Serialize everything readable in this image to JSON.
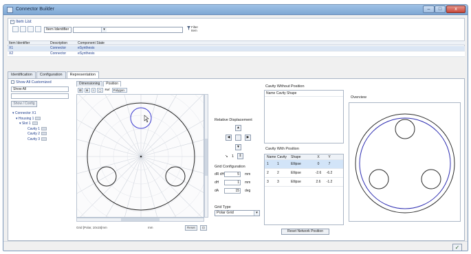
{
  "window": {
    "title": "Connector Builder",
    "minimize": "–",
    "maximize": "□",
    "close": "x"
  },
  "items_list": {
    "header": "Item List",
    "identifier_combo": "Item Identifier",
    "filter_label": "Filter\nItem",
    "columns": [
      "Item Identifier",
      "Description",
      "Component State"
    ],
    "rows": [
      {
        "id": "X1",
        "desc": "Connector",
        "state": "eSynthesis"
      },
      {
        "id": "X2",
        "desc": "Connector",
        "state": "eSynthesis"
      }
    ]
  },
  "tabs": [
    "Identification",
    "Configuration",
    "Representation"
  ],
  "left_panel": {
    "header": "Show All Customized",
    "show_all": "Show All",
    "blank_field": "",
    "button": "Show / Config",
    "tree": [
      {
        "label": "Connector X1",
        "indent": 0,
        "prefix": "▾ "
      },
      {
        "label": "Housing 1",
        "indent": 1,
        "prefix": "▾ ",
        "chip": true
      },
      {
        "label": "Slot 1",
        "indent": 2,
        "prefix": "▾ ",
        "chip": true
      },
      {
        "label": "Cavity 1",
        "indent": 3,
        "prefix": "",
        "chip": true
      },
      {
        "label": "Cavity 2",
        "indent": 3,
        "prefix": "",
        "chip": true
      },
      {
        "label": "Cavity 3",
        "indent": 3,
        "prefix": "",
        "chip": true
      }
    ]
  },
  "canvas": {
    "subtabs": [
      "Dimensioning",
      "Position"
    ],
    "tool_labels": [
      "⊞",
      "⊕",
      "○",
      "▢",
      "Ref",
      "Polygon"
    ],
    "status_text": "Grid [Polar, 10x15]mm",
    "status_value": "mm",
    "status_btn_1": "Reset",
    "status_btn_2": "⊡"
  },
  "controls": {
    "relative_displacement": "Relative Displacement",
    "arrow_up": "▲",
    "arrow_left": "◀",
    "arrow_right": "▶",
    "arrow_down": "▼",
    "step_label": "↘",
    "step_value": "1",
    "grid_configuration": "Grid Configuration",
    "rows": [
      {
        "k": "dR dH",
        "v": "5",
        "u": "mm"
      },
      {
        "k": "dH",
        "v": "1",
        "u": "mm"
      },
      {
        "k": "dA",
        "v": "15",
        "u": "deg"
      }
    ],
    "grid_type_label": "Grid Type",
    "grid_type_value": "Polar Grid"
  },
  "cavity_without_position": {
    "title": "Cavity Without Position",
    "header": "Name Cavity Shape"
  },
  "cavity_with_position": {
    "title": "Cavity With Position",
    "columns": [
      "Name",
      "Cavity",
      "Shape",
      "X",
      "Y"
    ],
    "rows": [
      {
        "name": "1",
        "cavity": "1",
        "shape": "Ellipse",
        "x": "0",
        "y": "7"
      },
      {
        "name": "2",
        "cavity": "2",
        "shape": "Ellipse",
        "x": "-2.6",
        "y": "-6.2"
      },
      {
        "name": "3",
        "cavity": "3",
        "shape": "Ellipse",
        "x": "2.6",
        "y": "-1.2"
      }
    ],
    "selected_index": 0
  },
  "reset_button": "Reset Network Position",
  "overview": {
    "title": "Overview"
  },
  "ok_button": "✓",
  "colors": {
    "accent": "#1e3d8c",
    "outline": "#3a3aa8",
    "selection": "#d2e4f8"
  }
}
